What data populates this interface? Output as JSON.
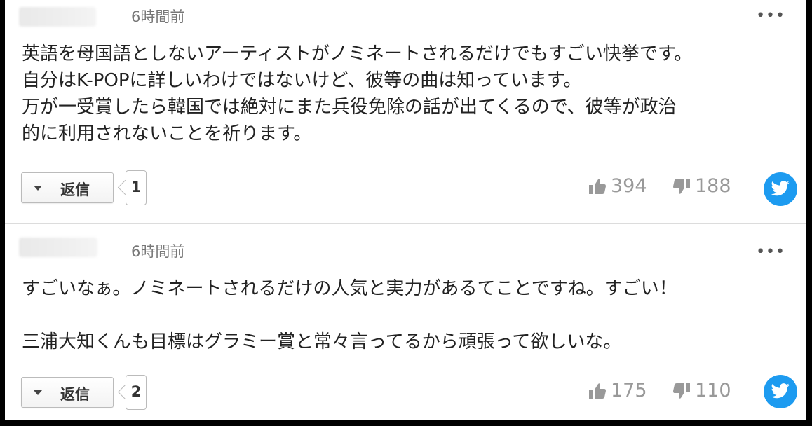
{
  "comments": [
    {
      "time": "6時間前",
      "more": "•••",
      "lines": [
        "英語を母国語としないアーティストがノミネートされるだけでもすごい快挙です。",
        "自分はK-POPに詳しいわけではないけど、彼等の曲は知っています。",
        "万が一受賞したら韓国では絶対にまた兵役免除の話が出てくるので、彼等が政治",
        "的に利用されないことを祈ります。"
      ],
      "reply_label": "返信",
      "reply_count": "1",
      "likes": "394",
      "dislikes": "188",
      "share_icon": "twitter-icon"
    },
    {
      "time": "6時間前",
      "more": "•••",
      "lines": [
        "すごいなぁ。ノミネートされるだけの人気と実力があるてことですね。すごい！",
        "三浦大知くんも目標はグラミー賞と常々言ってるから頑張って欲しいな。"
      ],
      "reply_label": "返信",
      "reply_count": "2",
      "likes": "175",
      "dislikes": "110",
      "share_icon": "twitter-icon"
    }
  ],
  "colors": {
    "twitter": "#1d9bf0",
    "vote_gray": "#999999",
    "text": "#222222"
  }
}
